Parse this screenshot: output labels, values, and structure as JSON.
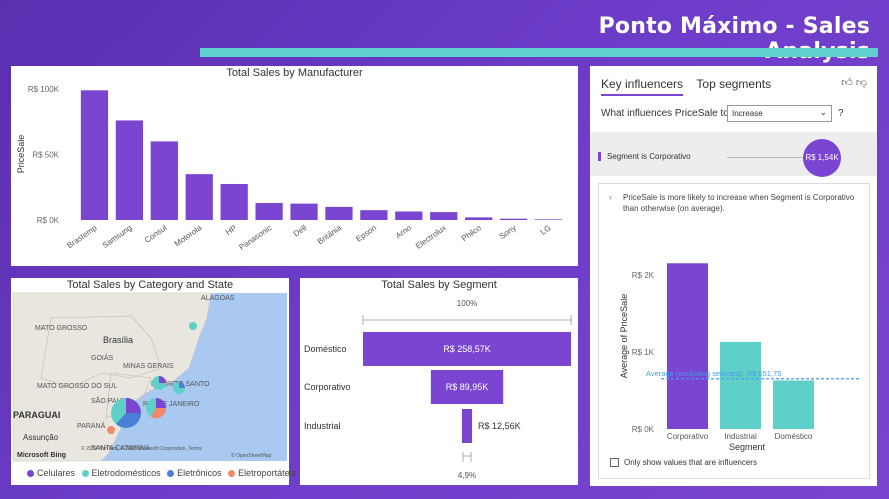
{
  "header": {
    "title": "Ponto Máximo - Sales Analysis",
    "bar_color": "#5fd0d0"
  },
  "manufacturer_chart": {
    "title": "Total Sales by Manufacturer",
    "ylabel": "PriceSale",
    "yticks": [
      "R$ 100K",
      "R$ 50K",
      "R$ 0K"
    ],
    "bar_color": "#7a45d0"
  },
  "map": {
    "title": "Total Sales by Category and State",
    "places": [
      "ALAGOAS",
      "MATO GROSSO",
      "Brasília",
      "GOIÁS",
      "MINAS GERAIS",
      "ESPÍRITO SANTO",
      "MATO GROSSO DO SUL",
      "SÃO PAULO",
      "RIO DE JANEIRO",
      "PARAGUAI",
      "PARANÁ",
      "SANTA CATARINA",
      "Assunção"
    ],
    "attribution": "© 2022 TomTom, © 2022 Microsoft Corporation, Terms",
    "attribution2": "© OpenStreetMap",
    "provider": "Microsoft Bing",
    "legend": [
      {
        "label": "Celulares",
        "color": "#7a45d0"
      },
      {
        "label": "Eletrodomésticos",
        "color": "#5fd0c8"
      },
      {
        "label": "Eletrônicos",
        "color": "#4a7fd8"
      },
      {
        "label": "Eletroportáteis",
        "color": "#f08a6a"
      }
    ]
  },
  "segment": {
    "title": "Total Sales by Segment",
    "top_pct": "100%",
    "bottom_pct": "4,9%"
  },
  "key_influencers": {
    "tabs": [
      "Key influencers",
      "Top segments"
    ],
    "question": "What influences PriceSale to",
    "select_value": "Increase",
    "help": "?",
    "segment_label": "Segment is Corporativo",
    "bubble": "R$ 1,54K",
    "description": "PriceSale is more likely to increase when Segment is Corporativo than otherwise (on average).",
    "yticks": [
      "R$ 2K",
      "R$ 1K",
      "R$ 0K"
    ],
    "ylabel": "Average of PriceSale",
    "xlabel": "Segment",
    "average_label": "Average (excluding selected): R$ 651,75",
    "checkbox_label": "Only show values that are influencers"
  },
  "chart_data": [
    {
      "type": "bar",
      "title": "Total Sales by Manufacturer",
      "ylabel": "PriceSale",
      "xlabel": "",
      "categories": [
        "Brastemp",
        "Samsung",
        "Consul",
        "Motorola",
        "HP",
        "Panasonic",
        "Dell",
        "Britânia",
        "Epson",
        "Arno",
        "Electrolux",
        "Philco",
        "Sony",
        "LG"
      ],
      "values": [
        99000,
        76000,
        60000,
        35000,
        27500,
        13000,
        12500,
        10000,
        7500,
        6500,
        6000,
        2000,
        1000,
        500
      ],
      "ylim": [
        0,
        100000
      ],
      "grid": false
    },
    {
      "type": "bar",
      "title": "Total Sales by Segment",
      "orientation": "horizontal-funnel",
      "categories": [
        "Doméstico",
        "Corporativo",
        "Industrial"
      ],
      "values": [
        258570,
        89950,
        12560
      ],
      "labels": [
        "R$ 258,57K",
        "R$ 89,95K",
        "R$ 12,56K"
      ]
    },
    {
      "type": "bar",
      "title": "",
      "ylabel": "Average of PriceSale",
      "xlabel": "Segment",
      "categories": [
        "Corporativo",
        "Industrial",
        "Doméstico"
      ],
      "values": [
        2150,
        1130,
        630
      ],
      "colors": [
        "#7a45d0",
        "#5fd0c8",
        "#5fd0c8"
      ],
      "ylim": [
        0,
        2400
      ],
      "reference_line": 651.75
    }
  ]
}
